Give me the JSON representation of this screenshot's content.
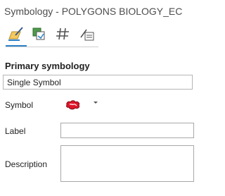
{
  "pane": {
    "title": "Symbology - POLYGONS BIOLOGY_EC"
  },
  "tabs": [
    {
      "name": "primary-symbology",
      "icon": "paintbrush-fill-icon",
      "active": true
    },
    {
      "name": "vary-symbology",
      "icon": "layered-squares-icon",
      "active": false
    },
    {
      "name": "symbol-layer-drawing",
      "icon": "hash-grid-icon",
      "active": false
    },
    {
      "name": "advanced-symbology-options",
      "icon": "pen-list-icon",
      "active": false
    }
  ],
  "primary": {
    "heading": "Primary symbology",
    "selected": "Single Symbol"
  },
  "form": {
    "symbol_label": "Symbol",
    "label_label": "Label",
    "description_label": "Description",
    "label_value": "",
    "description_value": ""
  },
  "colors": {
    "accent": "#2f82c8",
    "symbol_fill": "#e0142a",
    "symbol_outline": "#7a0b16"
  }
}
